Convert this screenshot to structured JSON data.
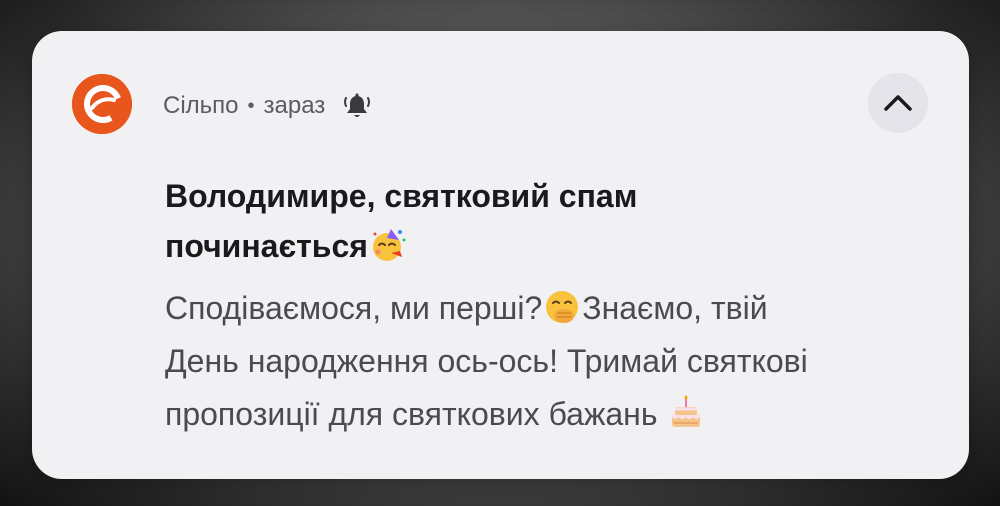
{
  "notification": {
    "app_name": "Сільпо",
    "separator": "•",
    "time": "зараз",
    "title_line1": "Володимире, святковий спам",
    "title_line2": "починається",
    "message_part1": "Сподіваємося, ми перші?",
    "message_part2": "Знаємо, твій",
    "message_line2": "День народження ось-ось! Тримай святкові",
    "message_line3": "пропозиції для святкових бажань ",
    "icons": {
      "app": "silpo-logo-icon",
      "bell": "bell-icon",
      "expand": "chevron-up-icon",
      "emoji_title": "partying-face-emoji",
      "emoji_message_1": "hand-over-mouth-emoji",
      "emoji_message_2": "birthday-cake-emoji"
    },
    "colors": {
      "brand": "#e8561d",
      "card_background": "#f1f1f3",
      "title_text": "#1a1a1d",
      "body_text": "#4a4a4f"
    }
  }
}
